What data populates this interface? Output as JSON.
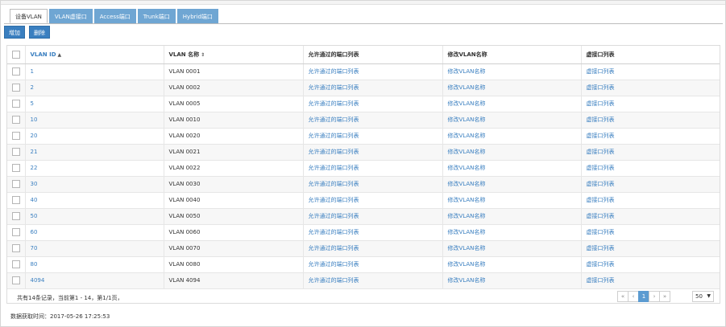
{
  "tabs": [
    {
      "label": "设备VLAN"
    },
    {
      "label": "VLAN虚接口"
    },
    {
      "label": "Access端口"
    },
    {
      "label": "Trunk端口"
    },
    {
      "label": "Hybrid端口"
    }
  ],
  "toolbar": {
    "add_label": "增加",
    "delete_label": "删除"
  },
  "table": {
    "headers": {
      "vlan_id": "VLAN ID",
      "vlan_name": "VLAN 名称",
      "allowed_ports": "允许通过的端口列表",
      "modify_name": "修改VLAN名称",
      "virtual_ports": "虚接口列表"
    },
    "sort_icons": {
      "asc": "▲",
      "both": "⇕"
    },
    "rows": [
      {
        "id": "1",
        "name": "VLAN 0001",
        "allowed": "允许通过的端口列表",
        "modify": "修改VLAN名称",
        "virtual": "虚接口列表"
      },
      {
        "id": "2",
        "name": "VLAN 0002",
        "allowed": "允许通过的端口列表",
        "modify": "修改VLAN名称",
        "virtual": "虚接口列表"
      },
      {
        "id": "5",
        "name": "VLAN 0005",
        "allowed": "允许通过的端口列表",
        "modify": "修改VLAN名称",
        "virtual": "虚接口列表"
      },
      {
        "id": "10",
        "name": "VLAN 0010",
        "allowed": "允许通过的端口列表",
        "modify": "修改VLAN名称",
        "virtual": "虚接口列表"
      },
      {
        "id": "20",
        "name": "VLAN 0020",
        "allowed": "允许通过的端口列表",
        "modify": "修改VLAN名称",
        "virtual": "虚接口列表"
      },
      {
        "id": "21",
        "name": "VLAN 0021",
        "allowed": "允许通过的端口列表",
        "modify": "修改VLAN名称",
        "virtual": "虚接口列表"
      },
      {
        "id": "22",
        "name": "VLAN 0022",
        "allowed": "允许通过的端口列表",
        "modify": "修改VLAN名称",
        "virtual": "虚接口列表"
      },
      {
        "id": "30",
        "name": "VLAN 0030",
        "allowed": "允许通过的端口列表",
        "modify": "修改VLAN名称",
        "virtual": "虚接口列表"
      },
      {
        "id": "40",
        "name": "VLAN 0040",
        "allowed": "允许通过的端口列表",
        "modify": "修改VLAN名称",
        "virtual": "虚接口列表"
      },
      {
        "id": "50",
        "name": "VLAN 0050",
        "allowed": "允许通过的端口列表",
        "modify": "修改VLAN名称",
        "virtual": "虚接口列表"
      },
      {
        "id": "60",
        "name": "VLAN 0060",
        "allowed": "允许通过的端口列表",
        "modify": "修改VLAN名称",
        "virtual": "虚接口列表"
      },
      {
        "id": "70",
        "name": "VLAN 0070",
        "allowed": "允许通过的端口列表",
        "modify": "修改VLAN名称",
        "virtual": "虚接口列表"
      },
      {
        "id": "80",
        "name": "VLAN 0080",
        "allowed": "允许通过的端口列表",
        "modify": "修改VLAN名称",
        "virtual": "虚接口列表"
      },
      {
        "id": "4094",
        "name": "VLAN 4094",
        "allowed": "允许通过的端口列表",
        "modify": "修改VLAN名称",
        "virtual": "虚接口列表"
      }
    ]
  },
  "footer": {
    "summary": "共有14条记录，当前第1 - 14，第1/1页，",
    "pager": {
      "first": "«",
      "prev": "‹",
      "current": "1",
      "next": "›",
      "last": "»"
    },
    "page_size": "50",
    "page_size_caret": "▼"
  },
  "fetch_time": "数据获取时间：2017-05-26 17:25:53",
  "colors": {
    "tab_blue": "#6fa6d3",
    "button_blue": "#3a7fc0",
    "link_blue": "#3a7fc0",
    "pager_active": "#5b9bd1"
  }
}
